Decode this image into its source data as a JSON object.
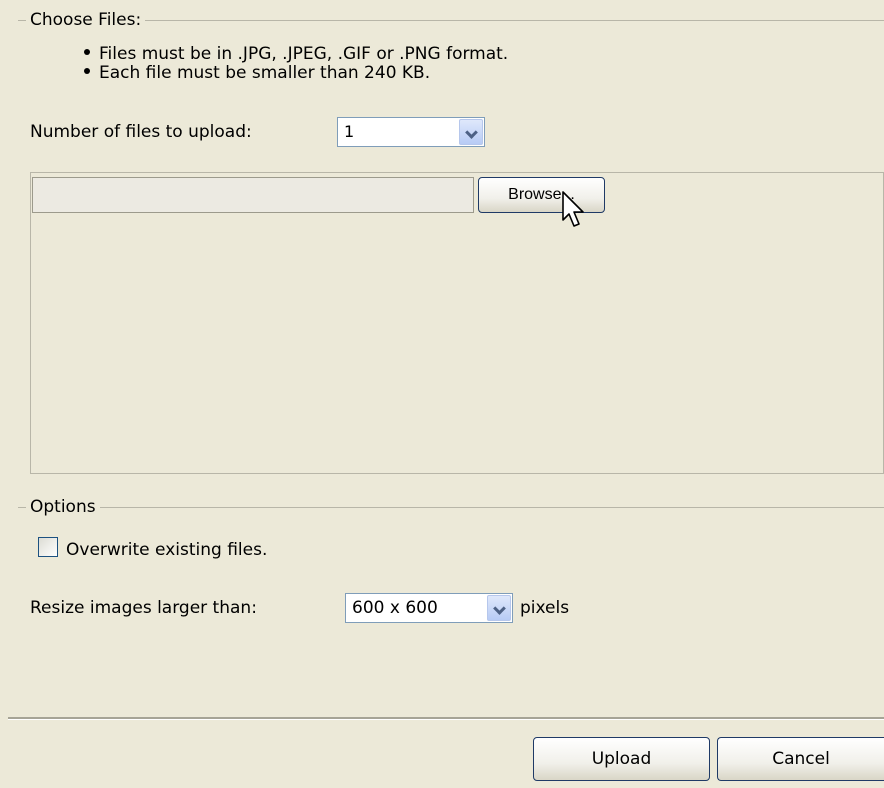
{
  "choose_files": {
    "legend": "Choose Files:",
    "rules": [
      "Files must be in .JPG, .JPEG, .GIF or .PNG format.",
      "Each file must be smaller than 240 KB."
    ],
    "count_label": "Number of files to upload:",
    "count_value": "1",
    "browse_label": "Browse..."
  },
  "options": {
    "legend": "Options",
    "overwrite_label": "Overwrite existing files.",
    "overwrite_checked": false,
    "resize_label": "Resize images larger than:",
    "resize_value": "600 x 600",
    "resize_suffix": "pixels"
  },
  "footer": {
    "upload_label": "Upload",
    "cancel_label": "Cancel"
  },
  "colors": {
    "background": "#ece9d8",
    "field_border": "#7f9db9",
    "button_border": "#1f3a66"
  }
}
